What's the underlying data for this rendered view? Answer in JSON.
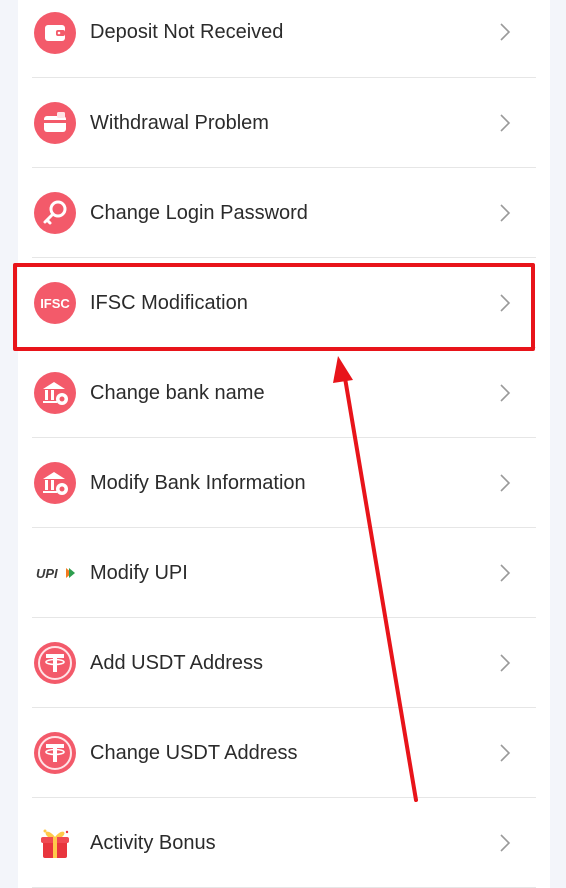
{
  "menu": {
    "items": [
      {
        "label": "Deposit Not Received",
        "icon": "wallet-icon"
      },
      {
        "label": "Withdrawal Problem",
        "icon": "wallet-card-icon"
      },
      {
        "label": "Change Login Password",
        "icon": "key-icon"
      },
      {
        "label": "IFSC Modification",
        "icon": "ifsc-icon",
        "badge_text": "IFSC"
      },
      {
        "label": "Change bank name",
        "icon": "bank-gear-icon"
      },
      {
        "label": "Modify Bank Information",
        "icon": "bank-gear-icon"
      },
      {
        "label": "Modify UPI",
        "icon": "upi-logo-icon",
        "logo_text": "UPI"
      },
      {
        "label": "Add USDT Address",
        "icon": "tether-icon"
      },
      {
        "label": "Change USDT Address",
        "icon": "tether-icon"
      },
      {
        "label": "Activity Bonus",
        "icon": "gift-icon"
      }
    ]
  },
  "annotation": {
    "highlighted_item": "IFSC Modification",
    "highlight_color": "#e8141a",
    "arrow_color": "#e8141a"
  },
  "colors": {
    "icon_primary": "#f35a6a",
    "icon_light": "#ffe3e6",
    "text": "#2b2b2b",
    "chevron": "#9a9a9a",
    "divider": "#e6e6e6"
  }
}
